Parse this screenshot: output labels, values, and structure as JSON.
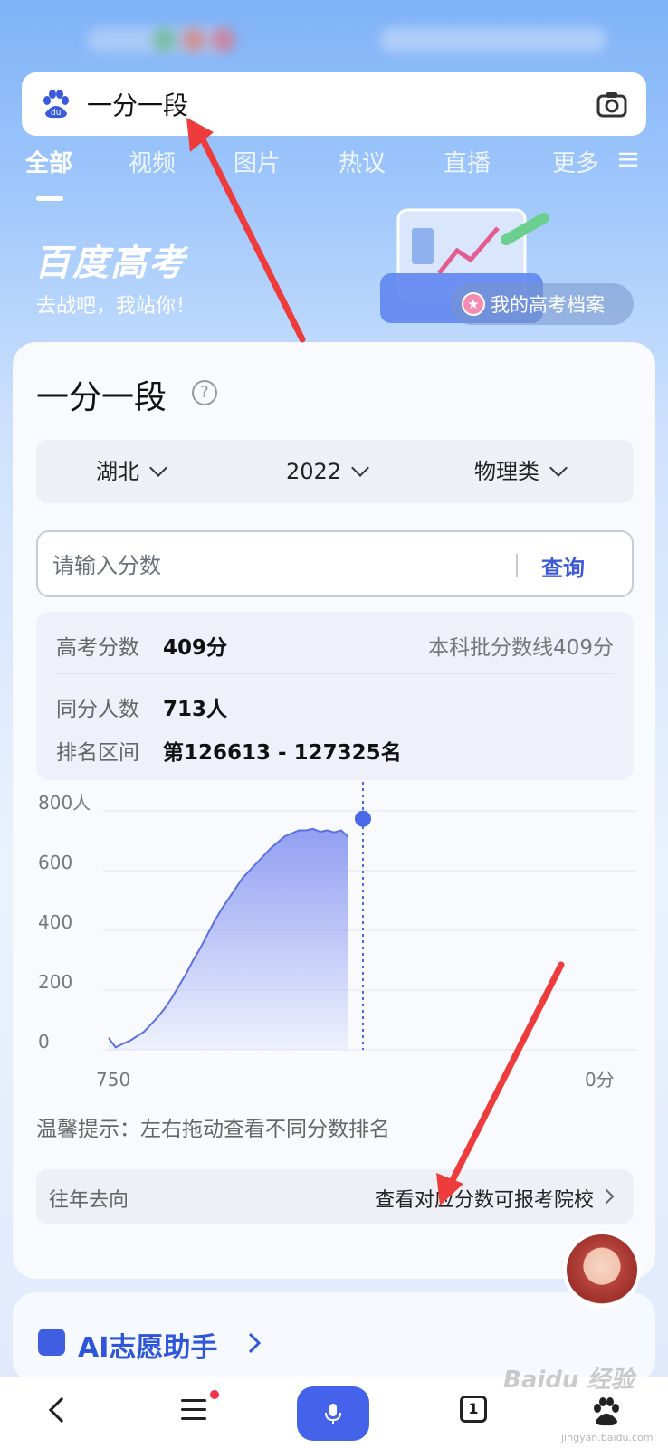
{
  "search": {
    "query": "一分一段"
  },
  "tabs": [
    {
      "label": "全部",
      "active": true
    },
    {
      "label": "视频"
    },
    {
      "label": "图片"
    },
    {
      "label": "热议"
    },
    {
      "label": "直播"
    },
    {
      "label": "更多"
    }
  ],
  "banner": {
    "title": "百度高考",
    "subtitle": "去战吧，我站你！",
    "archive_label": "我的高考档案"
  },
  "card": {
    "title": "一分一段",
    "filters": {
      "province": "湖北",
      "year": "2022",
      "subject": "物理类"
    },
    "input_placeholder": "请输入分数",
    "query_label": "查询",
    "result": {
      "score_label": "高考分数",
      "score_value": "409分",
      "line_note": "本科批分数线409分",
      "same_label": "同分人数",
      "same_value": "713人",
      "rank_label": "排名区间",
      "rank_value": "第126613 - 127325名"
    },
    "tip": "温馨提示：左右拖动查看不同分数排名",
    "past_label": "往年去向",
    "past_link": "查看对应分数可报考院校"
  },
  "chart_data": {
    "type": "area",
    "y_tick_labels": [
      "800人",
      "600",
      "400",
      "200",
      "0"
    ],
    "x_tick_labels": [
      "750",
      "0分"
    ],
    "ylim": [
      0,
      800
    ],
    "xlim": [
      750,
      0
    ],
    "x": [
      750,
      740,
      730,
      720,
      710,
      700,
      690,
      680,
      670,
      660,
      650,
      640,
      630,
      620,
      610,
      600,
      590,
      580,
      570,
      560,
      550,
      540,
      530,
      520,
      510,
      500,
      490,
      480,
      470,
      460,
      450,
      440,
      430,
      420,
      410
    ],
    "values": [
      40,
      8,
      20,
      30,
      45,
      60,
      85,
      110,
      140,
      175,
      215,
      255,
      300,
      340,
      385,
      430,
      470,
      505,
      540,
      575,
      600,
      625,
      650,
      675,
      695,
      715,
      725,
      735,
      735,
      740,
      730,
      735,
      728,
      735,
      713
    ],
    "marker": {
      "x": 409,
      "value": 713
    },
    "colors": {
      "line": "#5a6fe0",
      "fill": "#7f8ff0",
      "marker": "#4a68e8"
    }
  },
  "second_card": {
    "title": "AI志愿助手"
  },
  "bottom_nav": {
    "tab_count": "1"
  },
  "watermark": {
    "text": "Baidu 经验",
    "sub": "jingyan.baidu.com"
  }
}
